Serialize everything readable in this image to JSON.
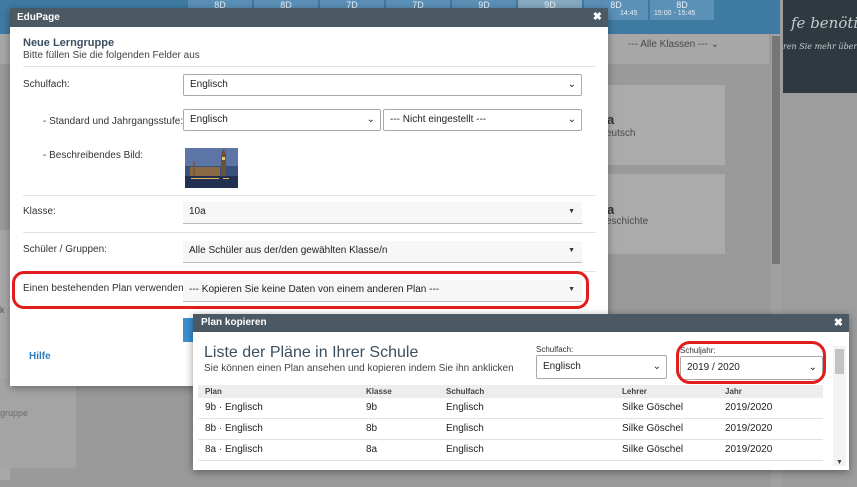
{
  "background": {
    "timetable_cells": [
      {
        "label": "8D",
        "light": false
      },
      {
        "label": "8D",
        "light": false
      },
      {
        "label": "7D",
        "light": false
      },
      {
        "label": "7D",
        "light": false
      },
      {
        "label": "9D",
        "light": false
      },
      {
        "label": "9D",
        "light": true
      },
      {
        "label": "8D",
        "light": false
      },
      {
        "label": "8D",
        "light": false
      }
    ],
    "time_1": "14:45",
    "time_2": "15:00 - 15:45",
    "chalk_line_1": "fe benötig",
    "chalk_line_2": "ren Sie mehr über",
    "filter_label": "--- Alle Klassen ---",
    "card_1_title": "a",
    "card_1_sub": "eutsch",
    "card_2_title": "a",
    "card_2_sub": "eschichte",
    "left_k": "k",
    "left_card_text": "gruppe"
  },
  "dialog": {
    "window_title": "EduPage",
    "heading": "Neue Lerngruppe",
    "subheading": "Bitte füllen Sie die folgenden Felder aus",
    "fields": {
      "schulfach_label": "Schulfach:",
      "schulfach_value": "Englisch",
      "standard_label": "- Standard und Jahrgangsstufe:",
      "standard_value": "Englisch",
      "jahrgang_value": "--- Nicht eingestellt ---",
      "bild_label": "- Beschreibendes Bild:",
      "klasse_label": "Klasse:",
      "klasse_value": "10a",
      "schueler_label": "Schüler / Gruppen:",
      "schueler_value": "Alle Schüler aus der/den gewählten Klasse/n",
      "plan_label": "Einen bestehenden Plan verwenden:",
      "plan_value": "--- Kopieren Sie keine Daten von einem anderen Plan ---"
    },
    "hilfe": "Hilfe"
  },
  "plan_dialog": {
    "window_title": "Plan kopieren",
    "heading": "Liste der Pläne in Ihrer Schule",
    "subheading": "Sie können einen Plan ansehen und kopieren indem Sie ihn anklicken",
    "schulfach_label": "Schulfach:",
    "schulfach_value": "Englisch",
    "schuljahr_label": "Schuljahr:",
    "schuljahr_value": "2019 / 2020",
    "columns": [
      "Plan",
      "Klasse",
      "Schulfach",
      "Lehrer",
      "Jahr"
    ],
    "rows": [
      [
        "9b · Englisch",
        "9b",
        "Englisch",
        "Silke Göschel",
        "2019/2020"
      ],
      [
        "8b · Englisch",
        "8b",
        "Englisch",
        "Silke Göschel",
        "2019/2020"
      ],
      [
        "8a · Englisch",
        "8a",
        "Englisch",
        "Silke Göschel",
        "2019/2020"
      ]
    ]
  },
  "colors": {
    "title_bar": "#4a5963",
    "highlight": "#e11d1d",
    "link": "#2b7ec1"
  }
}
